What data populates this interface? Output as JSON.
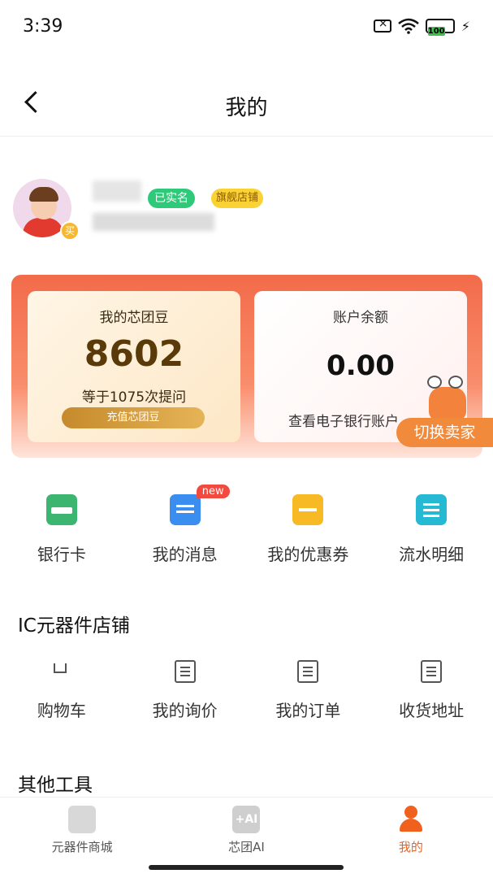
{
  "status_bar": {
    "time": "3:39",
    "battery": "100"
  },
  "header": {
    "title": "我的"
  },
  "profile": {
    "verified_label": "已实名",
    "store_label": "旗舰店铺",
    "role_badge": "买"
  },
  "wallet": {
    "beans_title": "我的芯团豆",
    "beans_value": "8602",
    "beans_equiv": "等于1075次提问",
    "recharge_label": "充值芯团豆",
    "balance_title": "账户余额",
    "balance_value": "0.00",
    "ebank_link": "查看电子银行账户",
    "switch_seller": "切换卖家"
  },
  "quick_actions": {
    "items": [
      {
        "label": "银行卡",
        "icon": "bank-card-icon",
        "color": "#3bb56f"
      },
      {
        "label": "我的消息",
        "icon": "message-icon",
        "color": "#3a8ef0",
        "badge": "new"
      },
      {
        "label": "我的优惠券",
        "icon": "coupon-icon",
        "color": "#f7b924"
      },
      {
        "label": "流水明细",
        "icon": "statement-icon",
        "color": "#25b9d4"
      }
    ]
  },
  "ic_store": {
    "title": "IC元器件店铺",
    "items": [
      {
        "label": "购物车",
        "icon": "cart-icon"
      },
      {
        "label": "我的询价",
        "icon": "inquiry-icon"
      },
      {
        "label": "我的订单",
        "icon": "order-icon"
      },
      {
        "label": "收货地址",
        "icon": "address-icon"
      }
    ]
  },
  "other_tools": {
    "title": "其他工具"
  },
  "bottom_nav": {
    "items": [
      {
        "label": "元器件商城",
        "icon": "chip-icon"
      },
      {
        "label": "芯团AI",
        "icon": "ai-icon",
        "icon_text": "+AI"
      },
      {
        "label": "我的",
        "icon": "user-icon",
        "active": true
      }
    ],
    "accent": "#f0611e"
  }
}
